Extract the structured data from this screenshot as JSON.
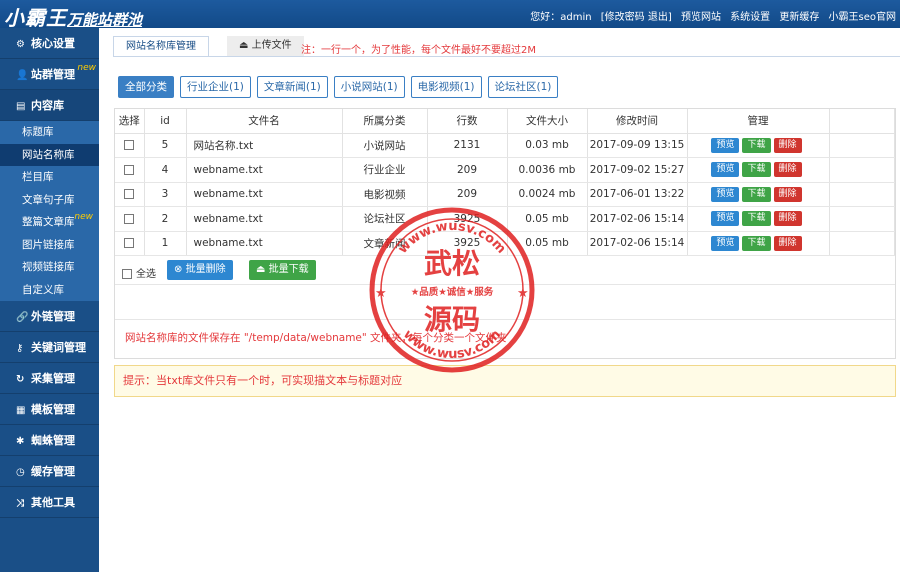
{
  "header": {
    "logo_main": "小霸王",
    "logo_sub": "万能站群池",
    "greeting": "您好：admin",
    "account_links": "[修改密码 退出]",
    "nav": [
      "预览网站",
      "系统设置",
      "更新缓存",
      "小霸王seo官网"
    ]
  },
  "sidebar": {
    "groups": [
      {
        "label": "核心设置",
        "icon": "gear-icon"
      },
      {
        "label": "站群管理",
        "icon": "user-icon",
        "badge": "new"
      },
      {
        "label": "内容库",
        "icon": "document-icon"
      },
      {
        "label": "外链管理",
        "icon": "link-icon"
      },
      {
        "label": "关键词管理",
        "icon": "key-icon"
      },
      {
        "label": "采集管理",
        "icon": "refresh-icon"
      },
      {
        "label": "模板管理",
        "icon": "grid-icon"
      },
      {
        "label": "蜘蛛管理",
        "icon": "spider-icon"
      },
      {
        "label": "缓存管理",
        "icon": "clock-icon"
      },
      {
        "label": "其他工具",
        "icon": "shuffle-icon"
      }
    ],
    "sub_items": [
      {
        "label": "标题库"
      },
      {
        "label": "网站名称库",
        "active": true
      },
      {
        "label": "栏目库"
      },
      {
        "label": "文章句子库"
      },
      {
        "label": "整篇文章库",
        "badge": "new"
      },
      {
        "label": "图片链接库"
      },
      {
        "label": "视频链接库"
      },
      {
        "label": "自定义库"
      }
    ]
  },
  "tabs": {
    "active_tab": "网站名称库管理",
    "upload_tab": "上传文件",
    "note": "注：一行一个，为了性能，每个文件最好不要超过2M"
  },
  "filters": [
    "全部分类",
    "行业企业(1)",
    "文章新闻(1)",
    "小说网站(1)",
    "电影视频(1)",
    "论坛社区(1)"
  ],
  "table": {
    "headers": [
      "选择",
      "id",
      "文件名",
      "所属分类",
      "行数",
      "文件大小",
      "修改时间",
      "管理",
      ""
    ],
    "rows": [
      {
        "id": "5",
        "filename": "网站名称.txt",
        "category": "小说网站",
        "lines": "2131",
        "size": "0.03 mb",
        "modified": "2017-09-09 13:15"
      },
      {
        "id": "4",
        "filename": "webname.txt",
        "category": "行业企业",
        "lines": "209",
        "size": "0.0036 mb",
        "modified": "2017-09-02 15:27"
      },
      {
        "id": "3",
        "filename": "webname.txt",
        "category": "电影视频",
        "lines": "209",
        "size": "0.0024 mb",
        "modified": "2017-06-01 13:22"
      },
      {
        "id": "2",
        "filename": "webname.txt",
        "category": "论坛社区",
        "lines": "3925",
        "size": "0.05 mb",
        "modified": "2017-02-06 15:14"
      },
      {
        "id": "1",
        "filename": "webname.txt",
        "category": "文章新闻",
        "lines": "3925",
        "size": "0.05 mb",
        "modified": "2017-02-06 15:14"
      }
    ],
    "actions": {
      "preview": "预览",
      "download": "下载",
      "delete": "删除"
    }
  },
  "bulk": {
    "select_all": "全选",
    "delete": "批量删除",
    "download": "批量下载"
  },
  "store_info": "网站名称库的文件保存在 \"/temp/data/webname\" 文件夹，每个分类一个文件夹",
  "tip": "提示：当txt库文件只有一个时，可实现描文本与标题对应",
  "watermark": {
    "line1": "武松",
    "line2": "源码",
    "slogan": "★品质★诚信★服务",
    "url_top": "www.wusv.com",
    "url_bottom": "www.wusv.com"
  },
  "colors": {
    "header_bg": "#1d5a9e",
    "sidebar_bg": "#1a4f87",
    "submenu_bg": "#2a68a8",
    "accent": "#3a7fc4",
    "preview_btn": "#2d87d1",
    "download_btn": "#3fa447",
    "delete_btn": "#d0352e",
    "note_red": "#e4393c"
  }
}
